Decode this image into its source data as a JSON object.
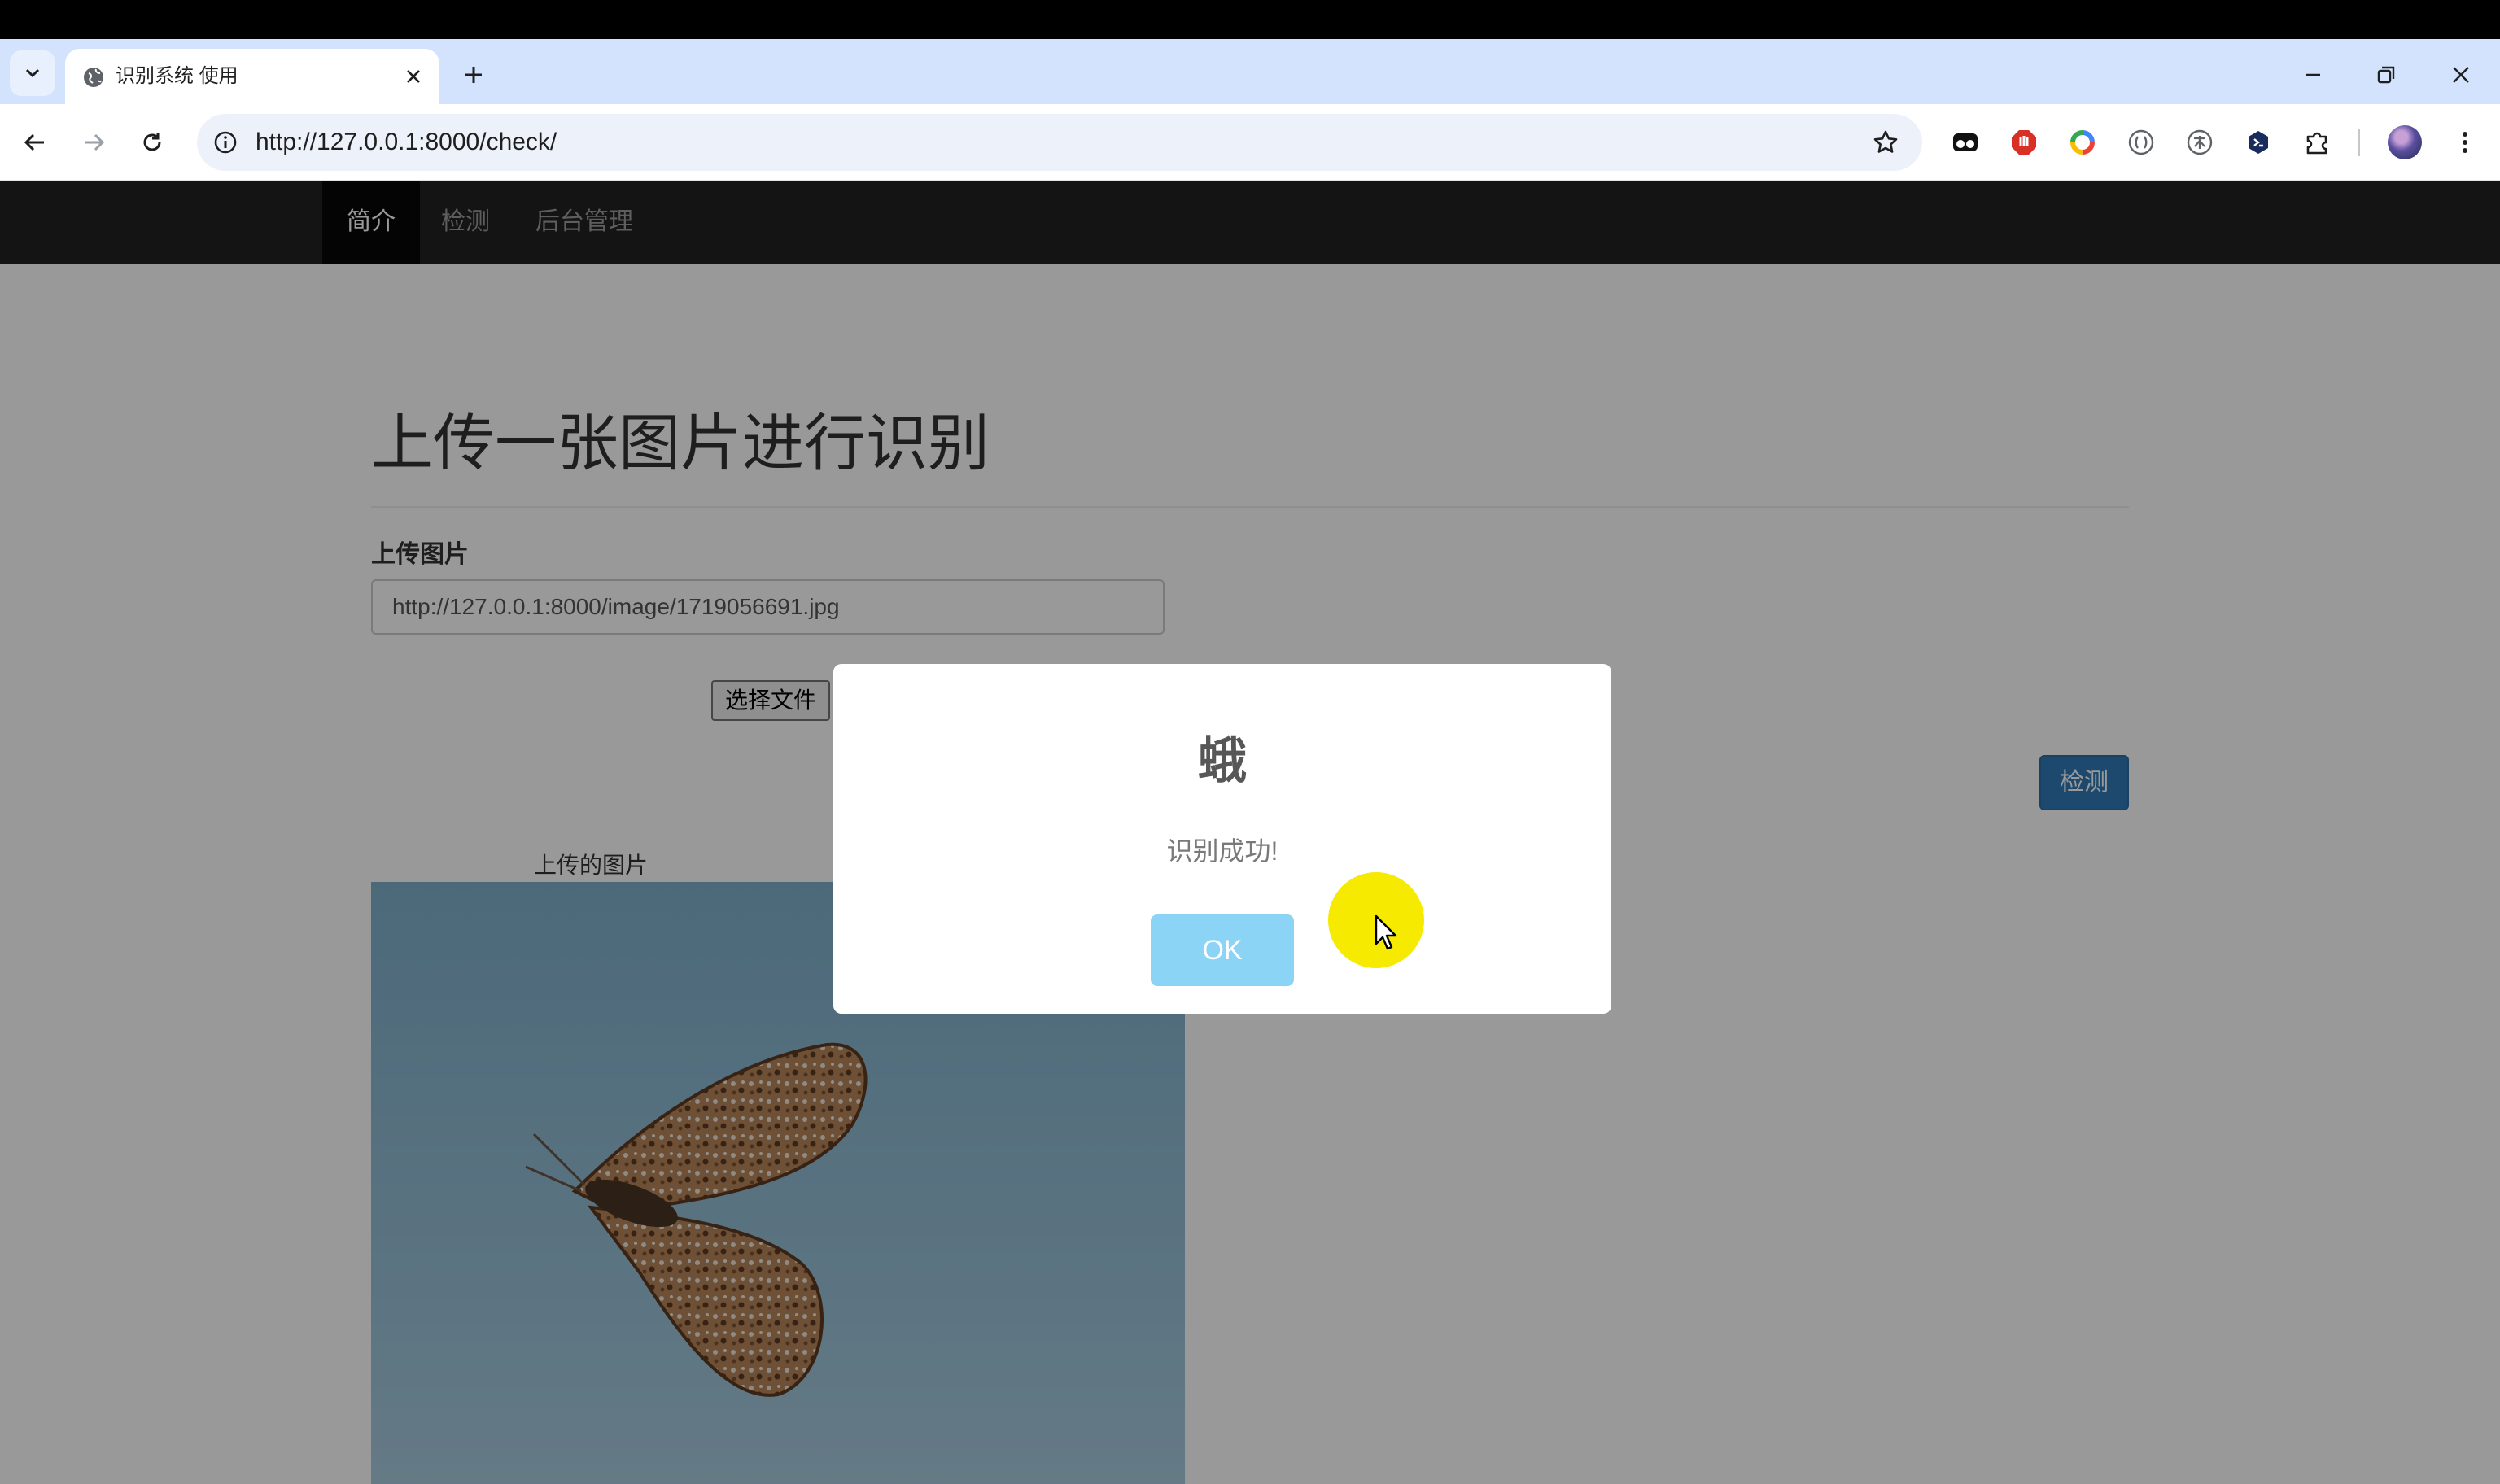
{
  "browser": {
    "tab_title": "识别系统 使用",
    "url": "http://127.0.0.1:8000/check/",
    "icons": {
      "tab_search": "chevron-down-icon",
      "favicon": "globe-icon",
      "tab_close": "close-icon",
      "new_tab": "plus-icon",
      "minimize": "minimize-icon",
      "restore": "restore-icon",
      "close_window": "close-icon",
      "back": "back-arrow-icon",
      "forward": "forward-arrow-icon",
      "reload": "reload-icon",
      "site_info": "info-icon",
      "bookmark": "star-icon",
      "extensions": [
        "extension-mask-icon",
        "extension-stop-icon",
        "extension-ring-icon",
        "extension-bracket-icon",
        "extension-translate-icon",
        "extension-hex-icon",
        "puzzle-icon"
      ],
      "menu": "more-vert-icon"
    }
  },
  "site": {
    "nav": [
      {
        "label": "简介",
        "active": true
      },
      {
        "label": "检测",
        "active": false
      },
      {
        "label": "后台管理",
        "active": false
      }
    ]
  },
  "main": {
    "heading": "上传一张图片进行识别",
    "upload_label": "上传图片",
    "upload_value": "http://127.0.0.1:8000/image/1719056691.jpg",
    "file_button": "选择文件",
    "detect_button": "检测",
    "image_caption": "上传的图片"
  },
  "modal": {
    "title": "蛾",
    "text": "识别成功!",
    "ok_button": "OK"
  },
  "colors": {
    "tabstrip": "#d3e3fd",
    "navbar": "#222222",
    "primary": "#337ab7",
    "ok_button": "#8cd4f5",
    "cursor_highlight": "#f5ea00"
  }
}
